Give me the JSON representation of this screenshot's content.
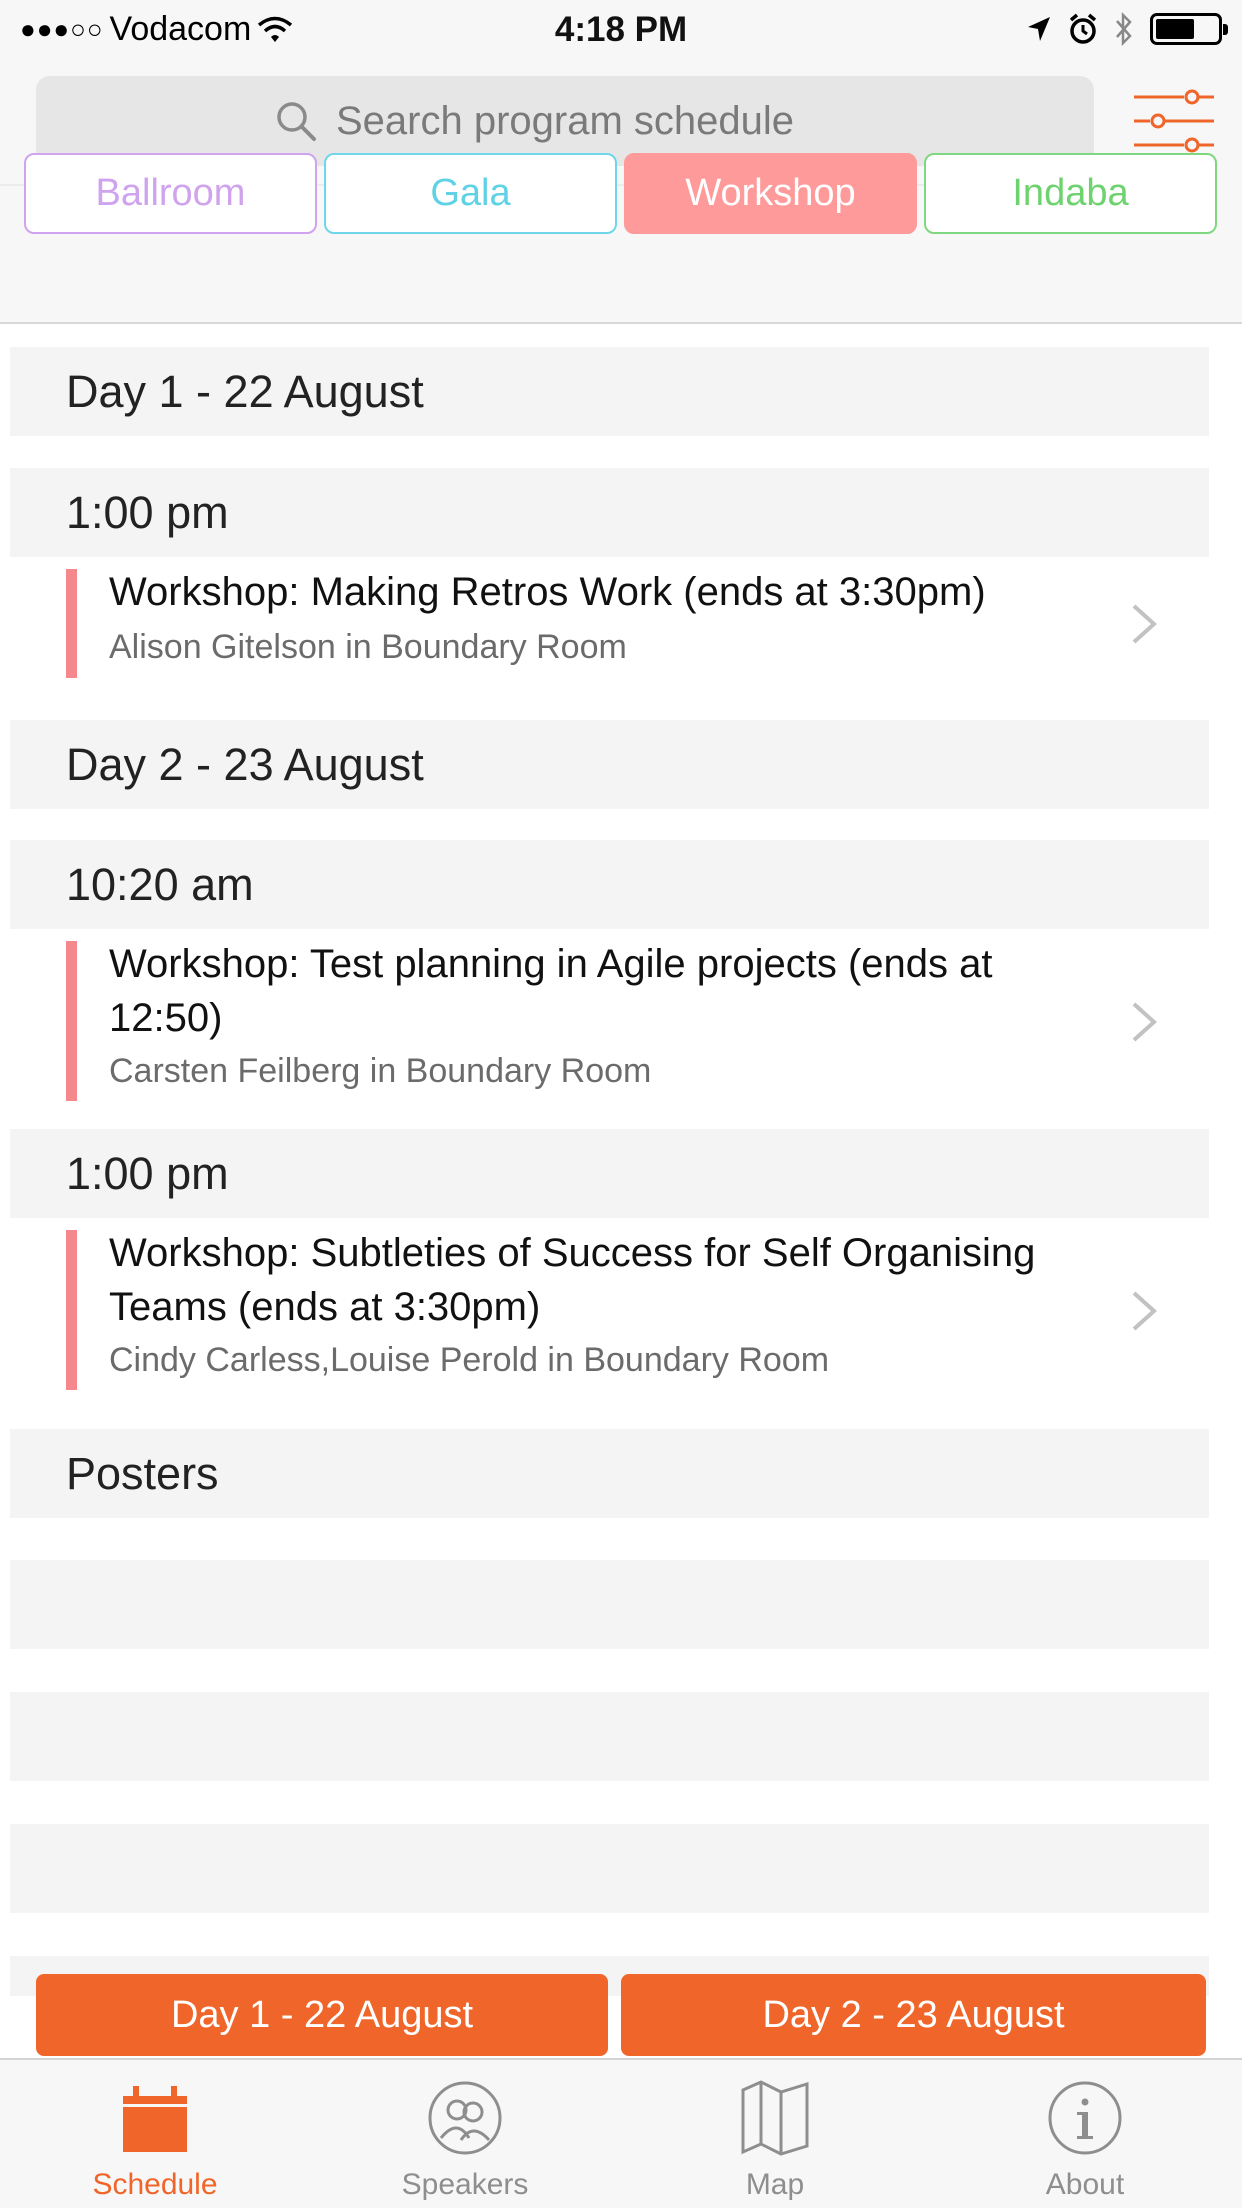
{
  "status_bar": {
    "signal": "●●●○○",
    "carrier": "Vodacom",
    "time": "4:18 PM"
  },
  "search": {
    "placeholder": "Search program schedule"
  },
  "filters": [
    {
      "label": "Ballroom",
      "color": "#cfa3ee",
      "selected": false
    },
    {
      "label": "Gala",
      "color": "#5fd2e6",
      "selected": false
    },
    {
      "label": "Workshop",
      "color": "#ff9a9a",
      "selected": true
    },
    {
      "label": "Indaba",
      "color": "#6ed36e",
      "selected": false
    }
  ],
  "schedule": {
    "day1_header": "Day 1 - 22 August",
    "day1_slot1_time": "1:00 pm",
    "day1_slot1_title": "Workshop: Making Retros Work (ends at 3:30pm)",
    "day1_slot1_sub": "Alison Gitelson in Boundary Room",
    "day2_header": "Day 2 - 23 August",
    "day2_slot1_time": "10:20 am",
    "day2_slot1_title": "Workshop: Test planning in Agile projects (ends at 12:50)",
    "day2_slot1_sub": "Carsten Feilberg in Boundary Room",
    "day2_slot2_time": "1:00 pm",
    "day2_slot2_title": "Workshop: Subtleties of Success for Self Organising Teams (ends at 3:30pm)",
    "day2_slot2_sub": "Cindy Carless,Louise Perold in Boundary Room",
    "posters_header": "Posters"
  },
  "day_buttons": {
    "day1": "Day 1 - 22 August",
    "day2": "Day 2 - 23 August"
  },
  "tabs": [
    {
      "label": "Schedule",
      "icon": "calendar-icon",
      "active": true
    },
    {
      "label": "Speakers",
      "icon": "speakers-icon",
      "active": false
    },
    {
      "label": "Map",
      "icon": "map-icon",
      "active": false
    },
    {
      "label": "About",
      "icon": "info-icon",
      "active": false
    }
  ],
  "colors": {
    "accent": "#f06529",
    "workshop_bar": "#f5888d"
  }
}
